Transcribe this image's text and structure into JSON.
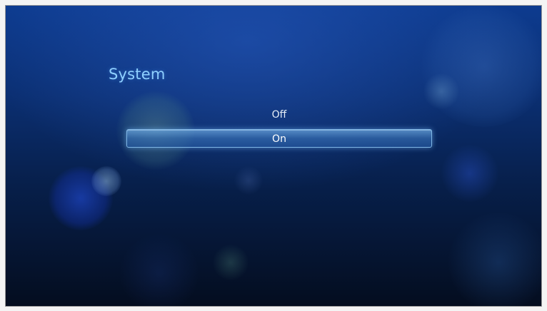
{
  "screen": {
    "title": "System"
  },
  "options": [
    {
      "label": "Off",
      "selected": false
    },
    {
      "label": "On",
      "selected": true
    }
  ],
  "colors": {
    "title": "#8fd0ff",
    "highlight": "#4a8fd0",
    "background_top": "#0d3b8f",
    "background_bottom": "#040d1f"
  }
}
